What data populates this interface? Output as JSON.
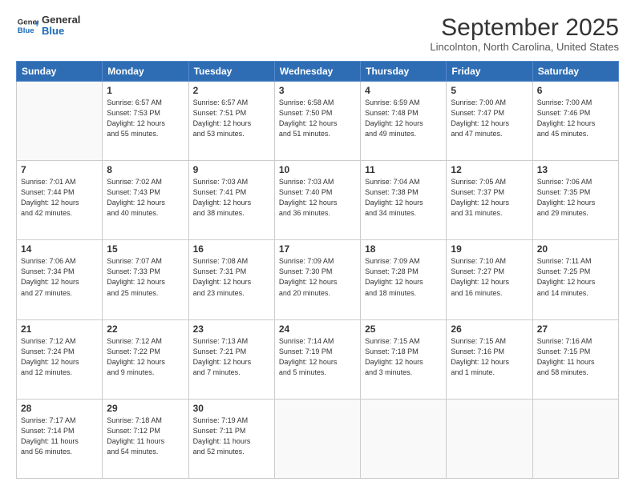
{
  "header": {
    "logo_line1": "General",
    "logo_line2": "Blue",
    "month": "September 2025",
    "location": "Lincolnton, North Carolina, United States"
  },
  "weekdays": [
    "Sunday",
    "Monday",
    "Tuesday",
    "Wednesday",
    "Thursday",
    "Friday",
    "Saturday"
  ],
  "weeks": [
    [
      {
        "day": "",
        "info": ""
      },
      {
        "day": "1",
        "info": "Sunrise: 6:57 AM\nSunset: 7:53 PM\nDaylight: 12 hours\nand 55 minutes."
      },
      {
        "day": "2",
        "info": "Sunrise: 6:57 AM\nSunset: 7:51 PM\nDaylight: 12 hours\nand 53 minutes."
      },
      {
        "day": "3",
        "info": "Sunrise: 6:58 AM\nSunset: 7:50 PM\nDaylight: 12 hours\nand 51 minutes."
      },
      {
        "day": "4",
        "info": "Sunrise: 6:59 AM\nSunset: 7:48 PM\nDaylight: 12 hours\nand 49 minutes."
      },
      {
        "day": "5",
        "info": "Sunrise: 7:00 AM\nSunset: 7:47 PM\nDaylight: 12 hours\nand 47 minutes."
      },
      {
        "day": "6",
        "info": "Sunrise: 7:00 AM\nSunset: 7:46 PM\nDaylight: 12 hours\nand 45 minutes."
      }
    ],
    [
      {
        "day": "7",
        "info": "Sunrise: 7:01 AM\nSunset: 7:44 PM\nDaylight: 12 hours\nand 42 minutes."
      },
      {
        "day": "8",
        "info": "Sunrise: 7:02 AM\nSunset: 7:43 PM\nDaylight: 12 hours\nand 40 minutes."
      },
      {
        "day": "9",
        "info": "Sunrise: 7:03 AM\nSunset: 7:41 PM\nDaylight: 12 hours\nand 38 minutes."
      },
      {
        "day": "10",
        "info": "Sunrise: 7:03 AM\nSunset: 7:40 PM\nDaylight: 12 hours\nand 36 minutes."
      },
      {
        "day": "11",
        "info": "Sunrise: 7:04 AM\nSunset: 7:38 PM\nDaylight: 12 hours\nand 34 minutes."
      },
      {
        "day": "12",
        "info": "Sunrise: 7:05 AM\nSunset: 7:37 PM\nDaylight: 12 hours\nand 31 minutes."
      },
      {
        "day": "13",
        "info": "Sunrise: 7:06 AM\nSunset: 7:35 PM\nDaylight: 12 hours\nand 29 minutes."
      }
    ],
    [
      {
        "day": "14",
        "info": "Sunrise: 7:06 AM\nSunset: 7:34 PM\nDaylight: 12 hours\nand 27 minutes."
      },
      {
        "day": "15",
        "info": "Sunrise: 7:07 AM\nSunset: 7:33 PM\nDaylight: 12 hours\nand 25 minutes."
      },
      {
        "day": "16",
        "info": "Sunrise: 7:08 AM\nSunset: 7:31 PM\nDaylight: 12 hours\nand 23 minutes."
      },
      {
        "day": "17",
        "info": "Sunrise: 7:09 AM\nSunset: 7:30 PM\nDaylight: 12 hours\nand 20 minutes."
      },
      {
        "day": "18",
        "info": "Sunrise: 7:09 AM\nSunset: 7:28 PM\nDaylight: 12 hours\nand 18 minutes."
      },
      {
        "day": "19",
        "info": "Sunrise: 7:10 AM\nSunset: 7:27 PM\nDaylight: 12 hours\nand 16 minutes."
      },
      {
        "day": "20",
        "info": "Sunrise: 7:11 AM\nSunset: 7:25 PM\nDaylight: 12 hours\nand 14 minutes."
      }
    ],
    [
      {
        "day": "21",
        "info": "Sunrise: 7:12 AM\nSunset: 7:24 PM\nDaylight: 12 hours\nand 12 minutes."
      },
      {
        "day": "22",
        "info": "Sunrise: 7:12 AM\nSunset: 7:22 PM\nDaylight: 12 hours\nand 9 minutes."
      },
      {
        "day": "23",
        "info": "Sunrise: 7:13 AM\nSunset: 7:21 PM\nDaylight: 12 hours\nand 7 minutes."
      },
      {
        "day": "24",
        "info": "Sunrise: 7:14 AM\nSunset: 7:19 PM\nDaylight: 12 hours\nand 5 minutes."
      },
      {
        "day": "25",
        "info": "Sunrise: 7:15 AM\nSunset: 7:18 PM\nDaylight: 12 hours\nand 3 minutes."
      },
      {
        "day": "26",
        "info": "Sunrise: 7:15 AM\nSunset: 7:16 PM\nDaylight: 12 hours\nand 1 minute."
      },
      {
        "day": "27",
        "info": "Sunrise: 7:16 AM\nSunset: 7:15 PM\nDaylight: 11 hours\nand 58 minutes."
      }
    ],
    [
      {
        "day": "28",
        "info": "Sunrise: 7:17 AM\nSunset: 7:14 PM\nDaylight: 11 hours\nand 56 minutes."
      },
      {
        "day": "29",
        "info": "Sunrise: 7:18 AM\nSunset: 7:12 PM\nDaylight: 11 hours\nand 54 minutes."
      },
      {
        "day": "30",
        "info": "Sunrise: 7:19 AM\nSunset: 7:11 PM\nDaylight: 11 hours\nand 52 minutes."
      },
      {
        "day": "",
        "info": ""
      },
      {
        "day": "",
        "info": ""
      },
      {
        "day": "",
        "info": ""
      },
      {
        "day": "",
        "info": ""
      }
    ]
  ]
}
